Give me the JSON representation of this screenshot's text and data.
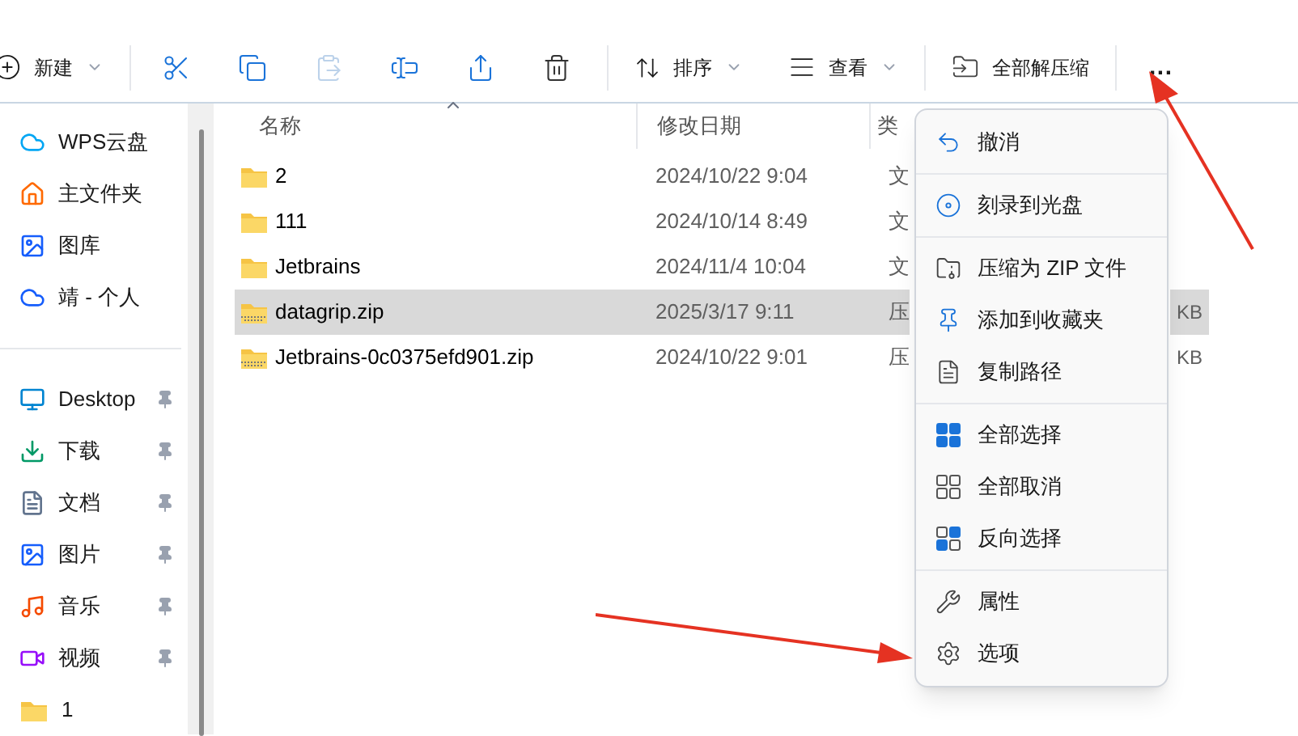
{
  "toolbar": {
    "new_button": {
      "label": "新建"
    },
    "icon_buttons": [
      {
        "disabled": false
      },
      {
        "disabled": false
      },
      {
        "disabled": true
      },
      {
        "disabled": false
      },
      {
        "disabled": false
      },
      {
        "disabled": false
      }
    ],
    "sort_button": {
      "label": "排序"
    },
    "view_button": {
      "label": "查看"
    },
    "extract_button": {
      "label": "全部解压缩"
    },
    "more_button": {
      "label": "..."
    }
  },
  "sidebar": {
    "items": [
      {
        "label": "WPS云盘",
        "pinned": false
      },
      {
        "label": "主文件夹",
        "pinned": false
      },
      {
        "label": "图库",
        "pinned": false
      },
      {
        "label": "靖 - 个人",
        "pinned": false
      }
    ],
    "quick_access": [
      {
        "label": "Desktop",
        "pinned": true
      },
      {
        "label": "下载",
        "pinned": true
      },
      {
        "label": "文档",
        "pinned": true
      },
      {
        "label": "图片",
        "pinned": true
      },
      {
        "label": "音乐",
        "pinned": true
      },
      {
        "label": "视频",
        "pinned": true
      },
      {
        "label": "1",
        "pinned": false
      }
    ]
  },
  "table": {
    "columns": [
      "名称",
      "修改日期",
      "类"
    ],
    "rows": [
      {
        "kind": "folder",
        "name": "2",
        "date": "2024/10/22 9:04",
        "type": "文",
        "selected": false
      },
      {
        "kind": "folder",
        "name": "111",
        "date": "2024/10/14 8:49",
        "type": "文",
        "selected": false
      },
      {
        "kind": "folder",
        "name": "Jetbrains",
        "date": "2024/11/4 10:04",
        "type": "文",
        "selected": false
      },
      {
        "kind": "zip",
        "name": "datagrip.zip",
        "date": "2025/3/17 9:11",
        "type": "压",
        "size": "KB",
        "selected": true
      },
      {
        "kind": "zip",
        "name": "Jetbrains-0c0375efd901.zip",
        "date": "2024/10/22 9:01",
        "type": "压",
        "size": "KB",
        "selected": false
      }
    ]
  },
  "context_menu": {
    "groups": [
      [
        "撤消"
      ],
      [
        "刻录到光盘"
      ],
      [
        "压缩为 ZIP 文件",
        "添加到收藏夹",
        "复制路径"
      ],
      [
        "全部选择",
        "全部取消",
        "反向选择"
      ],
      [
        "属性",
        "选项"
      ]
    ]
  }
}
